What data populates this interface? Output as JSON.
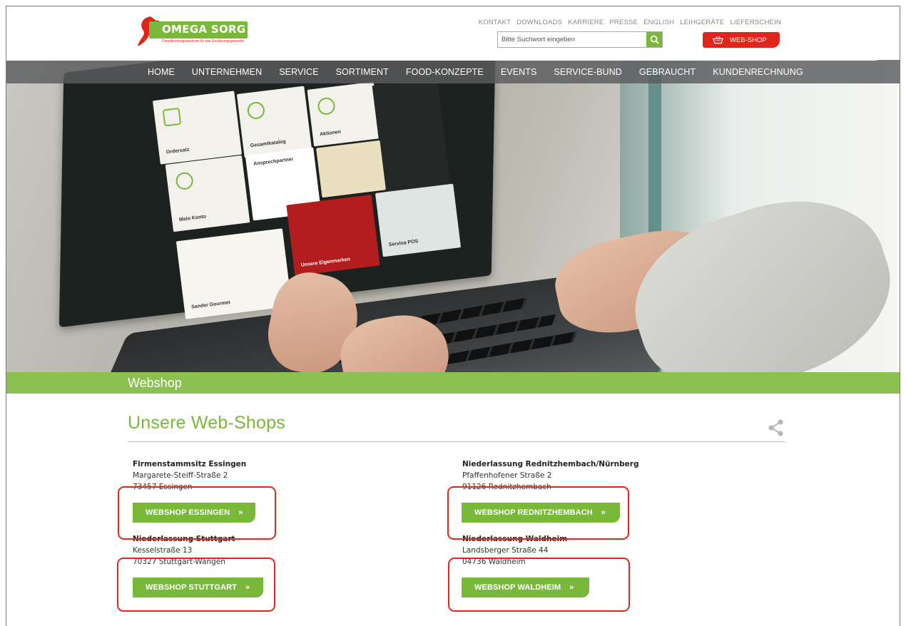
{
  "brand": {
    "name": "OMEGA SORG",
    "tagline": "Dienstleistungszentrum für das Ernährungsgewerbe",
    "green": "#7ab839",
    "red": "#e1251b"
  },
  "topnav": [
    "KONTAKT",
    "DOWNLOADS",
    "KARRIERE",
    "PRESSE",
    "ENGLISH",
    "LEIHGERÄTE",
    "LIEFERSCHEIN"
  ],
  "search": {
    "placeholder": "Bitte Suchwort eingeben",
    "icon": "search-icon"
  },
  "webshop_button": {
    "label": "WEB-SHOP",
    "icon": "basket-icon"
  },
  "main_nav": [
    "HOME",
    "UNTERNEHMEN",
    "SERVICE",
    "SORTIMENT",
    "FOOD-KONZEPTE",
    "EVENTS",
    "SERVICE-BUND",
    "GEBRAUCHT",
    "KUNDENRECHNUNG"
  ],
  "hero": {
    "tiles": {
      "ordersatz": "Ordersatz",
      "gesamtkatalog": "Gesamtkatalog",
      "aktionen": "Aktionen",
      "mein_konto": "Mein Konto",
      "ansprechpartner": "Ansprechpartner",
      "sander": "Sander Gourmet",
      "eigenmarken": "Unsere Eigenmarken",
      "servisa_pos": "Servisa POS"
    }
  },
  "band": {
    "title": "Webshop"
  },
  "section": {
    "title": "Unsere Web-Shops",
    "share_icon": "share-icon"
  },
  "branches": [
    {
      "name": "Firmenstammsitz Essingen",
      "street": "Margarete-Steiff-Straße 2",
      "city": "73457 Essingen",
      "button": "WEBSHOP ESSINGEN"
    },
    {
      "name": "Niederlassung Rednitzhembach/Nürnberg",
      "street": "Pfaffenhofener Straße 2",
      "city": "91126 Rednitzhembach",
      "button": "WEBSHOP REDNITZHEMBACH"
    },
    {
      "name": "Niederlassung Stuttgart",
      "street": "Kesselstraße 13",
      "city": "70327 Stuttgart-Wangen",
      "button": "WEBSHOP STUTTGART"
    },
    {
      "name": "Niederlassung Waldheim",
      "street": "Landsberger Straße 44",
      "city": "04736 Waldheim",
      "button": "WEBSHOP WALDHEIM"
    }
  ],
  "button_arrow": "»",
  "annotation_color": "#e1251b"
}
